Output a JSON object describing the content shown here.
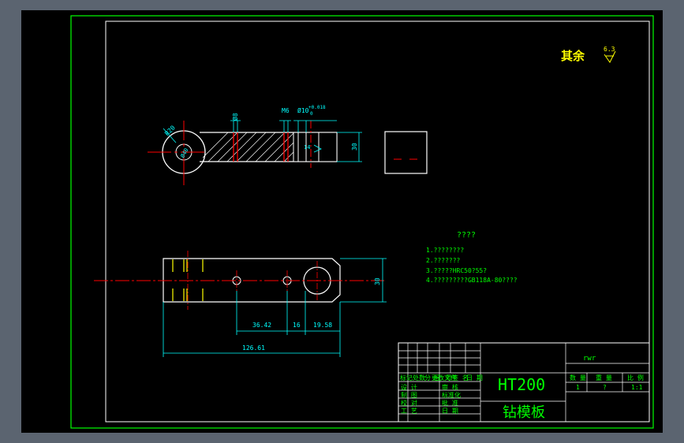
{
  "surface_finish": {
    "label": "其余",
    "value": "6.3"
  },
  "top_view": {
    "dims": {
      "d1": "Ø8",
      "m6": "M6",
      "h10": "Ø10",
      "h10_tol_up": "+0.018",
      "h10_tol_low": "0",
      "height": "30",
      "circle": "Ø40",
      "radius": "R20",
      "hole_label": "14"
    }
  },
  "bottom_view": {
    "dims": {
      "a": "36.42",
      "b": "16",
      "c": "19.58",
      "total": "126.61",
      "height": "30"
    }
  },
  "notes": {
    "heading": "????",
    "items": [
      "1.????????",
      "2.???????",
      "3.?????HRC50?55?",
      "4.?????????GB118A-80????"
    ]
  },
  "title_block": {
    "material": "HT200",
    "part_name": "钻模板",
    "code": "rwr",
    "qty_header": "数 量",
    "weight_header": "重 量",
    "scale_header": "比 例",
    "qty": "1",
    "weight": "?",
    "scale": "1:1",
    "rev_headers": [
      "标记",
      "处数",
      "分 区",
      "更改文件",
      "号签 名",
      "日 期"
    ],
    "rows": [
      {
        "k1": "设 计",
        "k2": "审 核"
      },
      {
        "k1": "制 图",
        "k2": "标准化"
      },
      {
        "k1": "校 对",
        "k2": "批 准"
      },
      {
        "k1": "工 艺",
        "k2": "日 期"
      }
    ]
  },
  "colors": {
    "border": "#00ff00",
    "part": "#ffffff",
    "center": "#ff0000",
    "dim": "#00ffff",
    "hatch": "#ffffff",
    "note": "#00ff00",
    "title": "#ffff00"
  }
}
